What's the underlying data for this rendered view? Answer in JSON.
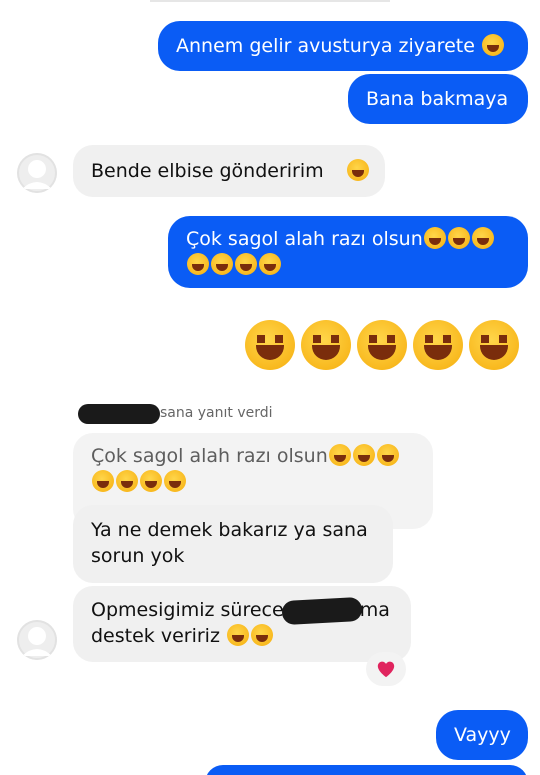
{
  "messages_out": {
    "m1": "Annem gelir avusturya ziyarete",
    "m2": "Bana bakmaya",
    "m3_line1": "Çok sagol alah razı olsun",
    "m_last": "Vayyy"
  },
  "messages_in": {
    "m1": "Bende elbise gönderirim",
    "reply_line1": "Ya ne demek bakarız ya sana",
    "reply_line2": "sorun yok",
    "m3_line1a": "Opmesigimiz sürece",
    "m3_line1b": "ma",
    "m3_line2": "destek veririz"
  },
  "reply_context": {
    "label": "sana yanıt verdi",
    "quoted_line1": "Çok sagol alah razı olsun"
  },
  "icons": {
    "emoji": "laughing-with-tears-emoji",
    "big_emoji": "grinning-squinting-face-emoji",
    "reaction": "red-heart-icon",
    "avatar": "default-avatar-icon"
  },
  "colors": {
    "outgoing_bubble": "#0a5cf5",
    "incoming_bubble": "#f0f0f0",
    "reaction_heart": "#e0245e"
  }
}
